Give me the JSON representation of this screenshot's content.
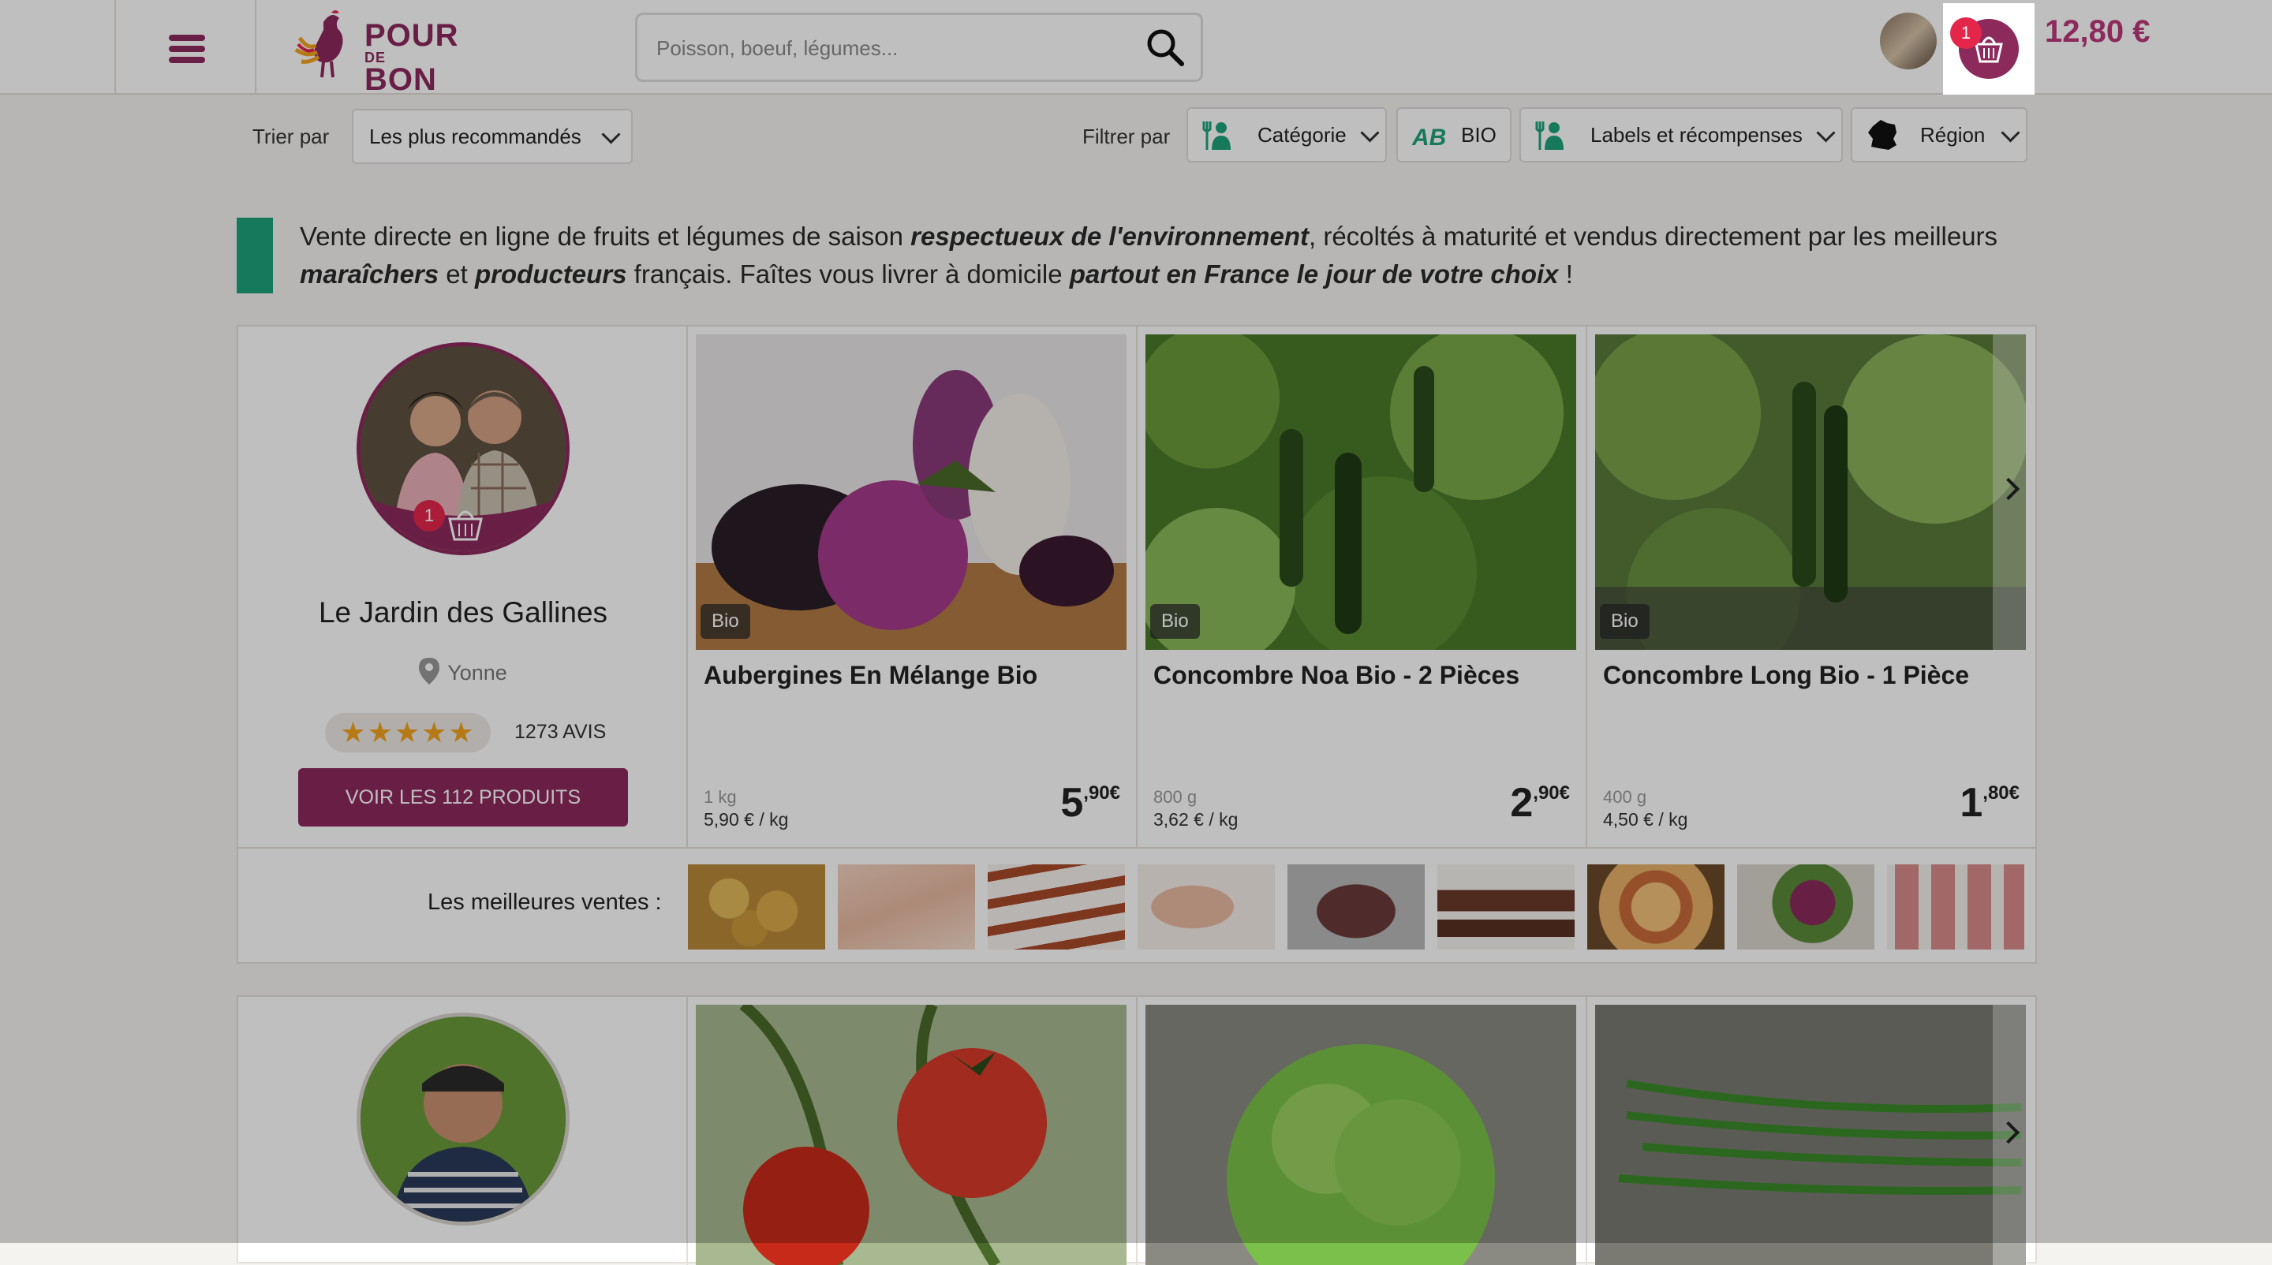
{
  "header": {
    "logo_line1": "POUR",
    "logo_line2": "DE",
    "logo_line3": "BON",
    "search_placeholder": "Poisson, boeuf, légumes...",
    "cart_count": "1",
    "cart_total": "12,80 €"
  },
  "toolbar": {
    "sort_label": "Trier par",
    "sort_value": "Les plus recommandés",
    "filter_label": "Filtrer par",
    "filters": [
      "Catégorie",
      "BIO",
      "Labels et récompenses",
      "Région"
    ]
  },
  "intro": {
    "p1": "Vente directe en ligne de fruits et légumes de saison ",
    "b1": "respectueux de l'environnement",
    "p2": ", récoltés à maturité et vendus directement par les meilleurs ",
    "b2": "maraîchers",
    "p3": " et ",
    "b3": "producteurs",
    "p4": " français. Faîtes vous livrer à domicile ",
    "b4": "partout en France le jour de votre choix",
    "p5": " !"
  },
  "producer1": {
    "cart_count": "1",
    "name": "Le Jardin des Gallines",
    "location": "Yonne",
    "stars": "★★★★★",
    "reviews": "1273 AVIS",
    "cta": "VOIR LES 112 PRODUITS",
    "best_label": "Les meilleures ventes :",
    "products": [
      {
        "badge": "Bio",
        "title": "Aubergines En Mélange Bio",
        "weight": "1 kg",
        "unit_price": "5,90 € / kg",
        "price_int": "5",
        "price_dec": ",90€"
      },
      {
        "badge": "Bio",
        "title": "Concombre Noa Bio - 2 Pièces",
        "weight": "800 g",
        "unit_price": "3,62 € / kg",
        "price_int": "2",
        "price_dec": ",90€"
      },
      {
        "badge": "Bio",
        "title": "Concombre Long Bio - 1 Pièce",
        "weight": "400 g",
        "unit_price": "4,50 € / kg",
        "price_int": "1",
        "price_dec": ",80€"
      }
    ]
  },
  "colors": {
    "brand": "#8c2a5c",
    "green": "#1fa27a",
    "badge_red": "#e3264a",
    "star": "#f2a21d"
  }
}
